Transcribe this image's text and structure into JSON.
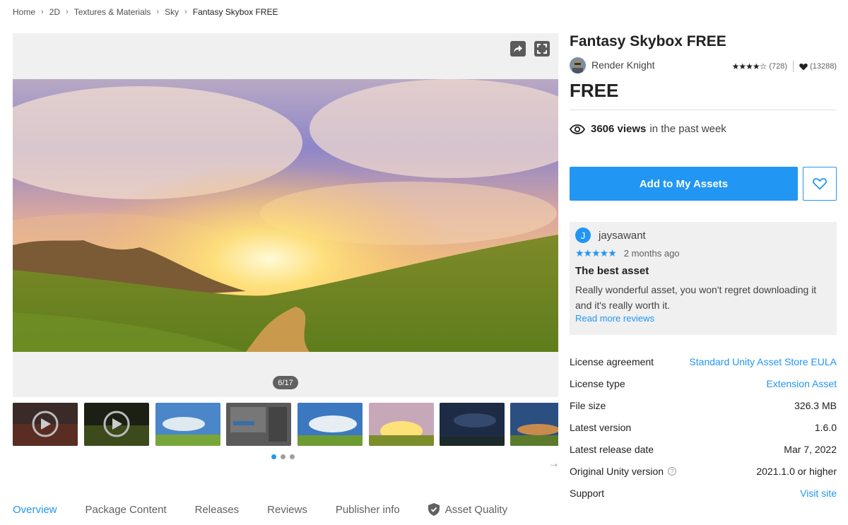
{
  "breadcrumb": [
    "Home",
    "2D",
    "Textures & Materials",
    "Sky",
    "Fantasy Skybox FREE"
  ],
  "gallery": {
    "counter": "6/17",
    "thumbnails": [
      "video-thumb-1",
      "video-thumb-2",
      "sky-thumb-3",
      "editor-thumb-4",
      "sky-thumb-5",
      "sunset-thumb-6",
      "night-thumb-7",
      "dusk-thumb-8"
    ],
    "dots": 3,
    "active_dot": 0
  },
  "tabs": [
    "Overview",
    "Package Content",
    "Releases",
    "Reviews",
    "Publisher info",
    "Asset Quality"
  ],
  "product": {
    "title": "Fantasy Skybox FREE",
    "publisher": "Render Knight",
    "stars": "★★★★☆",
    "rating_count": "(728)",
    "favorites": "(13288)",
    "price": "FREE",
    "views_count": "3606 views",
    "views_suffix": "in the past week",
    "add_button": "Add to My Assets"
  },
  "review": {
    "avatar_letter": "J",
    "user": "jaysawant",
    "stars": "★★★★★",
    "date": "2 months ago",
    "title": "The best asset",
    "body": "Really wonderful asset, you won't regret downloading it and it's really worth it.",
    "link": "Read more reviews"
  },
  "details": [
    {
      "label": "License agreement",
      "value": "Standard Unity Asset Store EULA",
      "link": true
    },
    {
      "label": "License type",
      "value": "Extension Asset",
      "link": true
    },
    {
      "label": "File size",
      "value": "326.3 MB",
      "link": false
    },
    {
      "label": "Latest version",
      "value": "1.6.0",
      "link": false
    },
    {
      "label": "Latest release date",
      "value": "Mar 7, 2022",
      "link": false
    },
    {
      "label": "Original Unity version",
      "value": "2021.1.0 or higher",
      "link": false,
      "help": true
    },
    {
      "label": "Support",
      "value": "Visit site",
      "link": true
    }
  ],
  "colors": {
    "accent": "#2196f3",
    "text": "#212121",
    "panel": "#f0f0f0"
  }
}
